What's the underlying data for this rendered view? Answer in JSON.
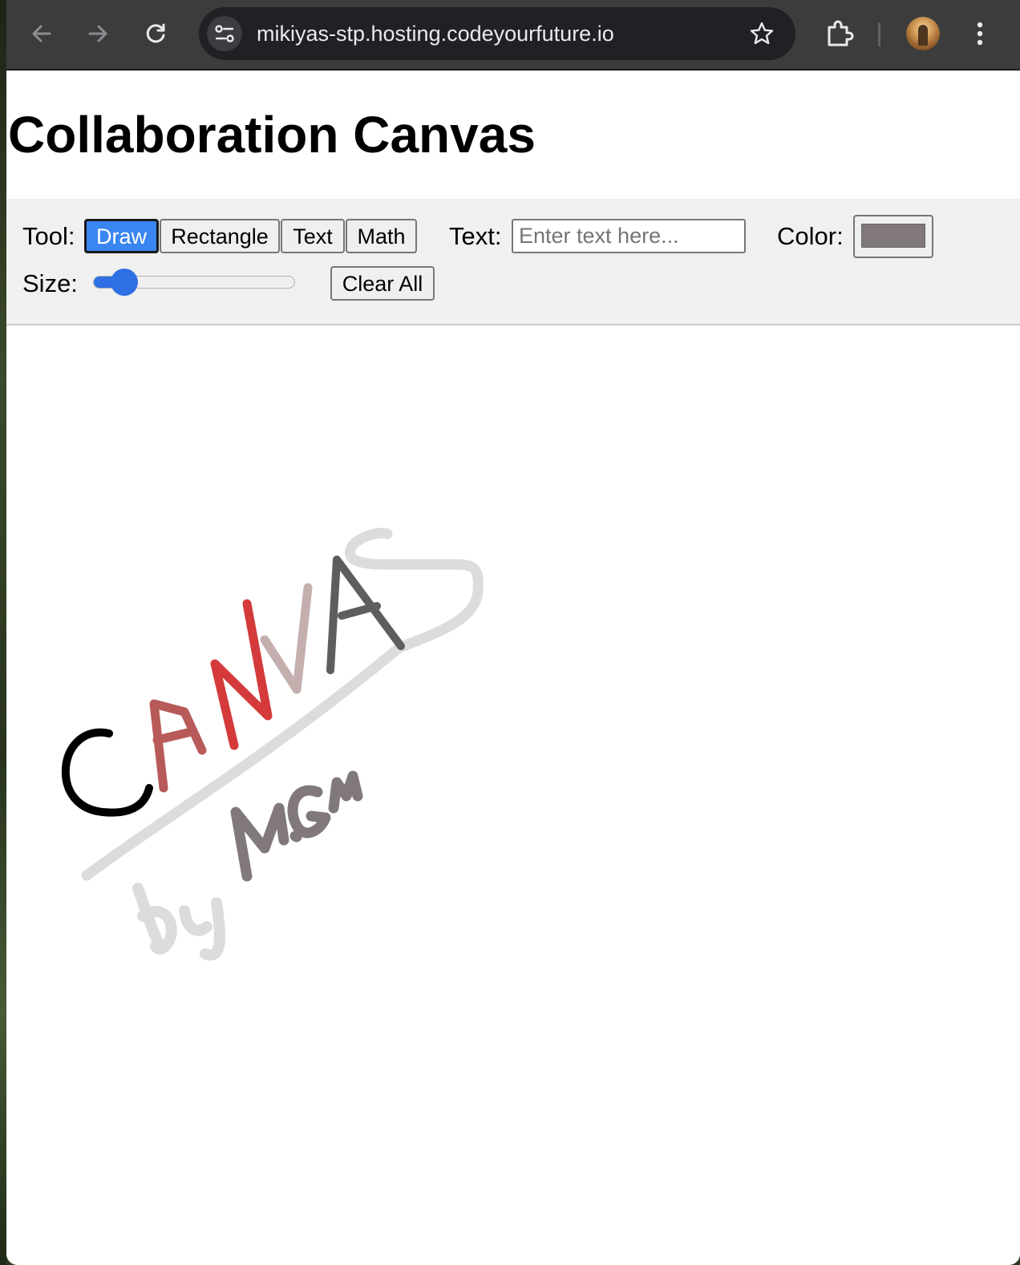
{
  "browser": {
    "url": "mikiyas-stp.hosting.codeyourfuture.io",
    "icons": [
      "back-arrow-icon",
      "forward-arrow-icon",
      "reload-icon",
      "site-settings-icon",
      "star-icon",
      "extensions-icon",
      "profile-avatar",
      "more-menu-icon"
    ]
  },
  "page": {
    "title": "Collaboration Canvas"
  },
  "controls": {
    "tool_label": "Tool:",
    "tools": [
      {
        "label": "Draw",
        "active": true
      },
      {
        "label": "Rectangle",
        "active": false
      },
      {
        "label": "Text",
        "active": false
      },
      {
        "label": "Math",
        "active": false
      }
    ],
    "text_label": "Text:",
    "text_value": "",
    "text_placeholder": "Enter text here...",
    "color_label": "Color:",
    "color_value": "#817979",
    "size_label": "Size:",
    "size_fraction": 0.1,
    "clear_label": "Clear All"
  },
  "canvas": {
    "stroke_colors": {
      "black": "#000000",
      "dark_red": "#b85a5a",
      "red": "#d43a3a",
      "mauve": "#c4aeae",
      "gray": "#5e5e5e",
      "light_gray": "#dcdcdc",
      "warm_gray": "#817979"
    }
  }
}
